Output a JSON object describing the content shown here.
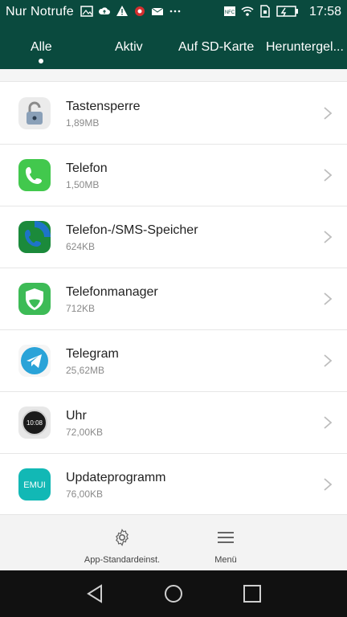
{
  "status": {
    "carrier": "Nur Notrufe",
    "time": "17:58",
    "icons_left": [
      "gallery-icon",
      "cloud-upload-icon",
      "warning-icon",
      "record-icon",
      "mail-icon",
      "more-icon"
    ],
    "icons_right": [
      "nfc-icon",
      "wifi-icon",
      "sim-icon",
      "battery-icon"
    ]
  },
  "tabs": [
    {
      "label": "Alle",
      "active": true
    },
    {
      "label": "Aktiv",
      "active": false
    },
    {
      "label": "Auf SD-Karte",
      "active": false
    },
    {
      "label": "Heruntergel...",
      "active": false
    }
  ],
  "apps": [
    {
      "name": "Tastensperre",
      "size": "1,89MB",
      "icon": "lock-icon",
      "color": "#e6e6e6"
    },
    {
      "name": "Telefon",
      "size": "1,50MB",
      "icon": "phone-icon",
      "color": "#42c84d"
    },
    {
      "name": "Telefon-/SMS-Speicher",
      "size": "624KB",
      "icon": "phone-storage-icon",
      "color": "#1b8a3b"
    },
    {
      "name": "Telefonmanager",
      "size": "712KB",
      "icon": "shield-icon",
      "color": "#3dbb56"
    },
    {
      "name": "Telegram",
      "size": "25,62MB",
      "icon": "telegram-icon",
      "color": "#2aa3d8"
    },
    {
      "name": "Uhr",
      "size": "72,00KB",
      "icon": "clock-icon",
      "clock_text": "10:08",
      "color": "#e7e7e7"
    },
    {
      "name": "Updateprogramm",
      "size": "76,00KB",
      "icon": "emui-icon",
      "icon_text": "EMUI",
      "color": "#12b8b5"
    }
  ],
  "bottom": {
    "settings_label": "App-Standardeinst.",
    "menu_label": "Menü"
  }
}
